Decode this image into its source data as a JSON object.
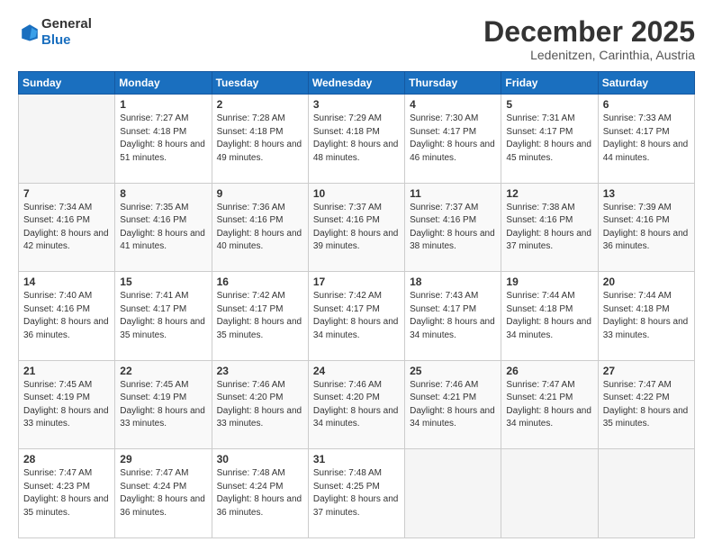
{
  "header": {
    "logo_line1": "General",
    "logo_line2": "Blue",
    "month": "December 2025",
    "location": "Ledenitzen, Carinthia, Austria"
  },
  "weekdays": [
    "Sunday",
    "Monday",
    "Tuesday",
    "Wednesday",
    "Thursday",
    "Friday",
    "Saturday"
  ],
  "weeks": [
    [
      {
        "day": "",
        "empty": true
      },
      {
        "day": "1",
        "sunrise": "7:27 AM",
        "sunset": "4:18 PM",
        "daylight": "8 hours and 51 minutes."
      },
      {
        "day": "2",
        "sunrise": "7:28 AM",
        "sunset": "4:18 PM",
        "daylight": "8 hours and 49 minutes."
      },
      {
        "day": "3",
        "sunrise": "7:29 AM",
        "sunset": "4:18 PM",
        "daylight": "8 hours and 48 minutes."
      },
      {
        "day": "4",
        "sunrise": "7:30 AM",
        "sunset": "4:17 PM",
        "daylight": "8 hours and 46 minutes."
      },
      {
        "day": "5",
        "sunrise": "7:31 AM",
        "sunset": "4:17 PM",
        "daylight": "8 hours and 45 minutes."
      },
      {
        "day": "6",
        "sunrise": "7:33 AM",
        "sunset": "4:17 PM",
        "daylight": "8 hours and 44 minutes."
      }
    ],
    [
      {
        "day": "7",
        "sunrise": "7:34 AM",
        "sunset": "4:16 PM",
        "daylight": "8 hours and 42 minutes."
      },
      {
        "day": "8",
        "sunrise": "7:35 AM",
        "sunset": "4:16 PM",
        "daylight": "8 hours and 41 minutes."
      },
      {
        "day": "9",
        "sunrise": "7:36 AM",
        "sunset": "4:16 PM",
        "daylight": "8 hours and 40 minutes."
      },
      {
        "day": "10",
        "sunrise": "7:37 AM",
        "sunset": "4:16 PM",
        "daylight": "8 hours and 39 minutes."
      },
      {
        "day": "11",
        "sunrise": "7:37 AM",
        "sunset": "4:16 PM",
        "daylight": "8 hours and 38 minutes."
      },
      {
        "day": "12",
        "sunrise": "7:38 AM",
        "sunset": "4:16 PM",
        "daylight": "8 hours and 37 minutes."
      },
      {
        "day": "13",
        "sunrise": "7:39 AM",
        "sunset": "4:16 PM",
        "daylight": "8 hours and 36 minutes."
      }
    ],
    [
      {
        "day": "14",
        "sunrise": "7:40 AM",
        "sunset": "4:16 PM",
        "daylight": "8 hours and 36 minutes."
      },
      {
        "day": "15",
        "sunrise": "7:41 AM",
        "sunset": "4:17 PM",
        "daylight": "8 hours and 35 minutes."
      },
      {
        "day": "16",
        "sunrise": "7:42 AM",
        "sunset": "4:17 PM",
        "daylight": "8 hours and 35 minutes."
      },
      {
        "day": "17",
        "sunrise": "7:42 AM",
        "sunset": "4:17 PM",
        "daylight": "8 hours and 34 minutes."
      },
      {
        "day": "18",
        "sunrise": "7:43 AM",
        "sunset": "4:17 PM",
        "daylight": "8 hours and 34 minutes."
      },
      {
        "day": "19",
        "sunrise": "7:44 AM",
        "sunset": "4:18 PM",
        "daylight": "8 hours and 34 minutes."
      },
      {
        "day": "20",
        "sunrise": "7:44 AM",
        "sunset": "4:18 PM",
        "daylight": "8 hours and 33 minutes."
      }
    ],
    [
      {
        "day": "21",
        "sunrise": "7:45 AM",
        "sunset": "4:19 PM",
        "daylight": "8 hours and 33 minutes."
      },
      {
        "day": "22",
        "sunrise": "7:45 AM",
        "sunset": "4:19 PM",
        "daylight": "8 hours and 33 minutes."
      },
      {
        "day": "23",
        "sunrise": "7:46 AM",
        "sunset": "4:20 PM",
        "daylight": "8 hours and 33 minutes."
      },
      {
        "day": "24",
        "sunrise": "7:46 AM",
        "sunset": "4:20 PM",
        "daylight": "8 hours and 34 minutes."
      },
      {
        "day": "25",
        "sunrise": "7:46 AM",
        "sunset": "4:21 PM",
        "daylight": "8 hours and 34 minutes."
      },
      {
        "day": "26",
        "sunrise": "7:47 AM",
        "sunset": "4:21 PM",
        "daylight": "8 hours and 34 minutes."
      },
      {
        "day": "27",
        "sunrise": "7:47 AM",
        "sunset": "4:22 PM",
        "daylight": "8 hours and 35 minutes."
      }
    ],
    [
      {
        "day": "28",
        "sunrise": "7:47 AM",
        "sunset": "4:23 PM",
        "daylight": "8 hours and 35 minutes."
      },
      {
        "day": "29",
        "sunrise": "7:47 AM",
        "sunset": "4:24 PM",
        "daylight": "8 hours and 36 minutes."
      },
      {
        "day": "30",
        "sunrise": "7:48 AM",
        "sunset": "4:24 PM",
        "daylight": "8 hours and 36 minutes."
      },
      {
        "day": "31",
        "sunrise": "7:48 AM",
        "sunset": "4:25 PM",
        "daylight": "8 hours and 37 minutes."
      },
      {
        "day": "",
        "empty": true
      },
      {
        "day": "",
        "empty": true
      },
      {
        "day": "",
        "empty": true
      }
    ]
  ]
}
